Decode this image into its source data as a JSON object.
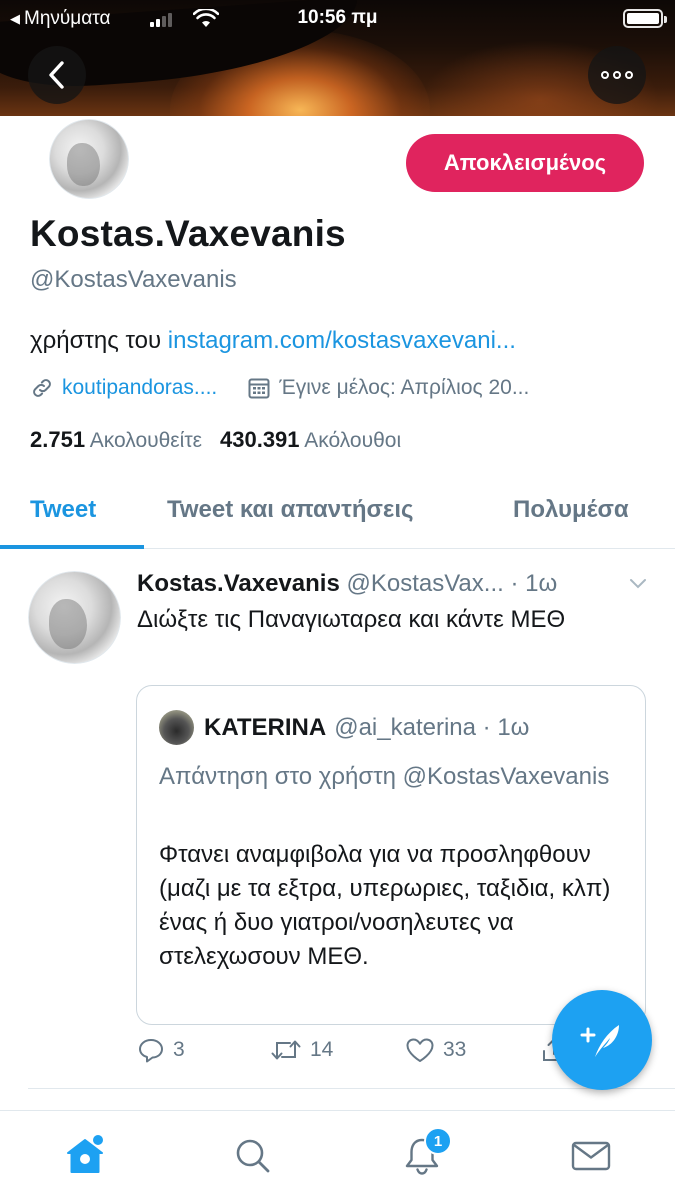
{
  "status_bar": {
    "back_app": "Μηνύματα",
    "time": "10:56 πμ"
  },
  "profile": {
    "action_button": "Αποκλεισμένος",
    "display_name": "Kostas.Vaxevanis",
    "handle": "@KostasVaxevanis",
    "bio_prefix": "χρήστης του ",
    "bio_link": "instagram.com/kostasvaxevani...",
    "website": "koutipandoras....",
    "joined": "Έγινε μέλος: Απρίλιος 20...",
    "following_count": "2.751",
    "following_label": "Ακολουθείτε",
    "followers_count": "430.391",
    "followers_label": "Ακόλουθοι"
  },
  "tabs": [
    {
      "label": "Tweet"
    },
    {
      "label": "Tweet και απαντήσεις"
    },
    {
      "label": "Πολυμέσα"
    }
  ],
  "tweet": {
    "name": "Kostas.Vaxevanis",
    "user": "@KostasVax...",
    "time": "· 1ω",
    "text": "Διώξτε τις Παναγιωταρεα και κάντε ΜΕΘ",
    "quote": {
      "name": "KATERINA",
      "user": "@ai_katerina",
      "time": "· 1ω",
      "reply_to": "Απάντηση στο χρήστη @KostasVaxevanis",
      "text": "Φτανει αναμφιβολα για να προσληφθουν (μαζι με τα εξτρα, υπερωριες, ταξιδια, κλπ) ένας ή δυο γιατροι/νοσηλευτες να στελεχωσουν ΜΕΘ."
    },
    "replies": "3",
    "retweets": "14",
    "likes": "33"
  },
  "bottom_nav": {
    "notification_badge": "1"
  },
  "colors": {
    "accent": "#1b95e0",
    "blocked": "#e0245e",
    "secondary_text": "#657786",
    "fab": "#1da1f2"
  }
}
